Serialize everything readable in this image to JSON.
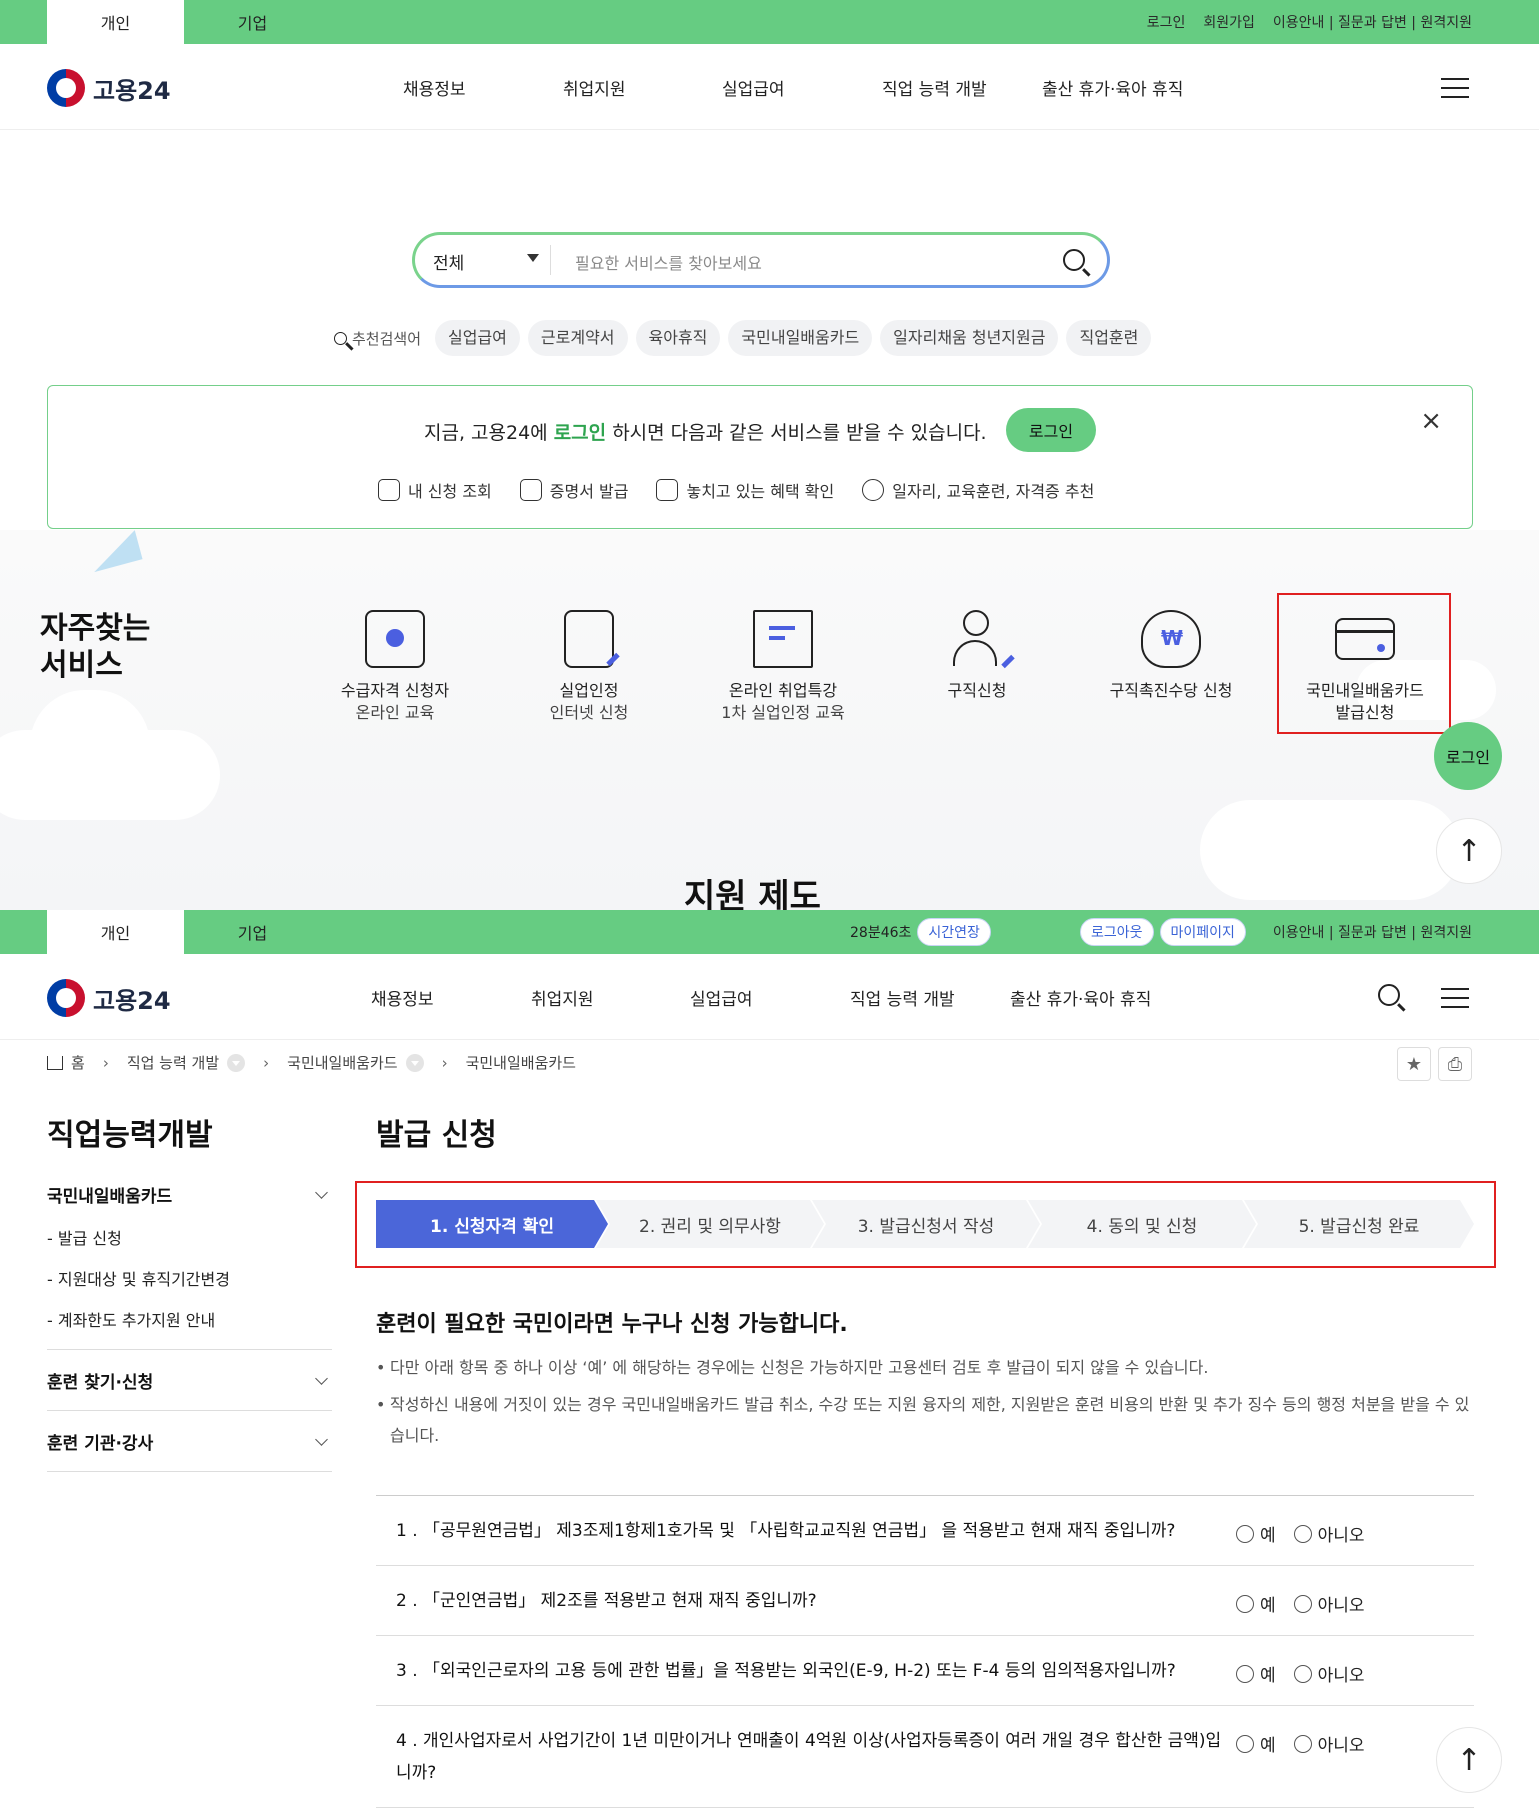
{
  "top": {
    "tabs": [
      "개인",
      "기업"
    ],
    "util_links": [
      "로그인",
      "회원가입",
      "이용안내 | 질문과 답변 | 원격지원"
    ]
  },
  "header": {
    "logo": "고용24",
    "nav": [
      "채용정보",
      "취업지원",
      "실업급여",
      "직업 능력 개발",
      "출산 휴가·육아 휴직"
    ]
  },
  "search": {
    "scope": "전체",
    "placeholder": "필요한 서비스를 찾아보세요",
    "recommend_label": "추천검색어",
    "keywords": [
      "실업급여",
      "근로계약서",
      "육아휴직",
      "국민내일배움카드",
      "일자리채움 청년지원금",
      "직업훈련"
    ]
  },
  "login_banner": {
    "msg_before": "지금, 고용24에 ",
    "msg_highlight": "로그인",
    "msg_after": " 하시면 다음과 같은 서비스를 받을 수 있습니다.",
    "button": "로그인",
    "close": "×",
    "benefits": [
      "내 신청 조회",
      "증명서 발급",
      "놓치고 있는 혜택 확인",
      "일자리, 교육훈련, 자격증 추천"
    ]
  },
  "frequent": {
    "title_line1": "자주찾는",
    "title_line2": "서비스",
    "services": [
      {
        "line1": "수급자격 신청자",
        "line2": "온라인 교육",
        "icon": "monitor-play-icon"
      },
      {
        "line1": "실업인정",
        "line2": "인터넷 신청",
        "icon": "document-pen-icon"
      },
      {
        "line1": "온라인 취업특강",
        "line2": "1차 실업인정 교육",
        "icon": "presentation-board-icon"
      },
      {
        "line1": "구직신청",
        "line2": "",
        "icon": "person-pen-icon"
      },
      {
        "line1": "구직촉진수당 신청",
        "line2": "",
        "icon": "money-bag-icon"
      },
      {
        "line1": "국민내일배움카드",
        "line2": "발급신청",
        "icon": "card-icon"
      }
    ],
    "float_login": "로그인",
    "cut_title": "지원 제도"
  },
  "top2": {
    "tabs": [
      "개인",
      "기업"
    ],
    "timer": "28분46초",
    "extend": "시간연장",
    "logout": "로그아웃",
    "mypage": "마이페이지",
    "util": "이용안내 | 질문과 답변 | 원격지원"
  },
  "header2": {
    "logo": "고용24",
    "nav": [
      "채용정보",
      "취업지원",
      "실업급여",
      "직업 능력 개발",
      "출산 휴가·육아 휴직"
    ]
  },
  "breadcrumb": [
    "홈",
    "직업 능력 개발",
    "국민내일배움카드",
    "국민내일배움카드"
  ],
  "sidebar": {
    "title": "직업능력개발",
    "sections": [
      {
        "label": "국민내일배움카드",
        "subs": [
          "- 발급 신청",
          "- 지원대상 및 휴직기간변경",
          "- 계좌한도 추가지원 안내"
        ]
      },
      {
        "label": "훈련 찾기·신청",
        "subs": []
      },
      {
        "label": "훈련 기관·강사",
        "subs": []
      }
    ]
  },
  "main": {
    "title": "발급 신청",
    "steps": [
      "1. 신청자격 확인",
      "2. 권리 및 의무사항",
      "3. 발급신청서 작성",
      "4. 동의 및 신청",
      "5. 발급신청 완료"
    ],
    "heading": "훈련이 필요한 국민이라면 누구나 신청 가능합니다.",
    "notes": [
      "다만 아래 항목 중 하나 이상 ‘예’ 에 해당하는 경우에는 신청은 가능하지만 고용센터 검토 후 발급이 되지 않을 수 있습니다.",
      "작성하신 내용에 거짓이 있는 경우 국민내일배움카드 발급 취소, 수강 또는 지원 융자의 제한, 지원받은 훈련 비용의 반환 및 추가 징수 등의 행정 처분을 받을 수 있습니다."
    ],
    "questions": [
      "1 . 「공무원연금법」 제3조제1항제1호가목 및 「사립학교교직원 연금법」 을 적용받고 현재 재직 중입니까?",
      "2 . 「군인연금법」 제2조를 적용받고 현재 재직 중입니까?",
      "3 . 「외국인근로자의 고용 등에 관한 법률」을 적용받는 외국인(E-9, H-2) 또는 F-4 등의 임의적용자입니까?",
      "4 . 개인사업자로서 사업기간이 1년 미만이거나 연매출이 4억원 이상(사업자등록증이 여러 개일 경우 합산한 금액)입니까?"
    ],
    "yes": "예",
    "no": "아니오"
  }
}
